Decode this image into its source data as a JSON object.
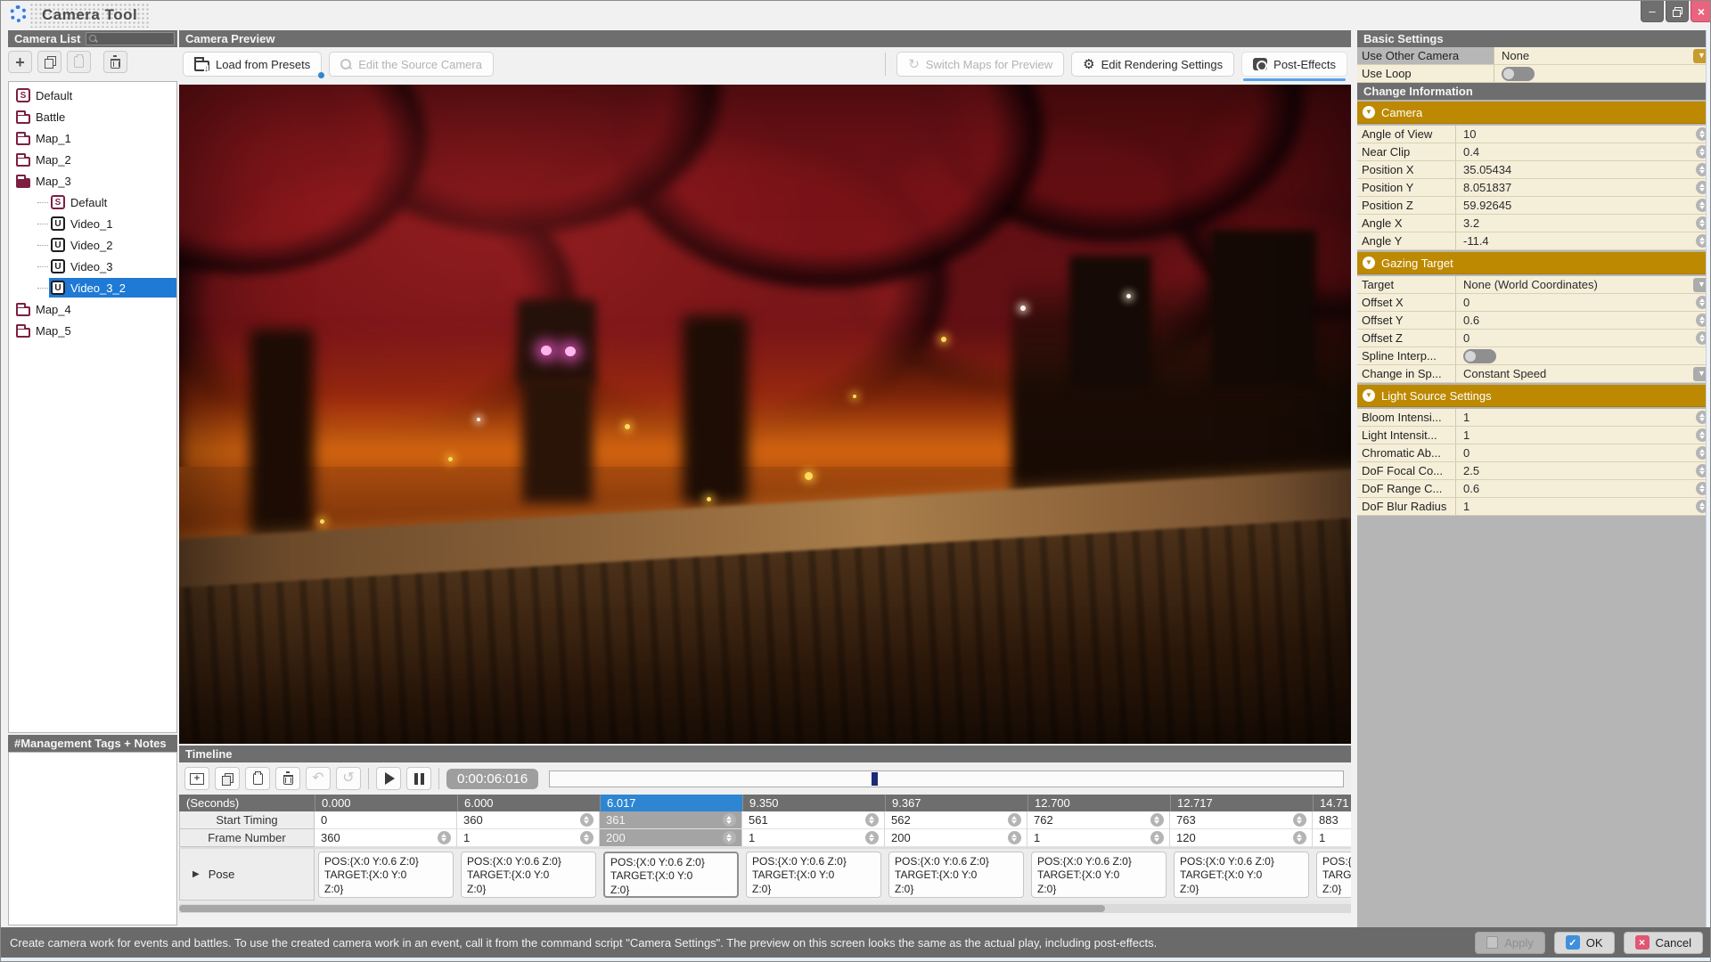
{
  "window": {
    "title": "Camera Tool"
  },
  "icons": {
    "chevron_down": "▼",
    "minimize": "–",
    "close": "×",
    "undo": "↶",
    "redo": "↺",
    "gear": "⚙",
    "refresh": "↻",
    "triangle_right": "▶"
  },
  "camera_list": {
    "title": "Camera List",
    "search_placeholder": "",
    "tree": [
      {
        "label": "Default",
        "icon": "script",
        "depth": 0,
        "selected": false
      },
      {
        "label": "Battle",
        "icon": "folder",
        "depth": 0,
        "selected": false
      },
      {
        "label": "Map_1",
        "icon": "folder",
        "depth": 0,
        "selected": false
      },
      {
        "label": "Map_2",
        "icon": "folder",
        "depth": 0,
        "selected": false
      },
      {
        "label": "Map_3",
        "icon": "folder-open",
        "depth": 0,
        "selected": false
      },
      {
        "label": "Default",
        "icon": "script",
        "depth": 1,
        "selected": false
      },
      {
        "label": "Video_1",
        "icon": "video",
        "depth": 1,
        "selected": false
      },
      {
        "label": "Video_2",
        "icon": "video",
        "depth": 1,
        "selected": false
      },
      {
        "label": "Video_3",
        "icon": "video",
        "depth": 1,
        "selected": false
      },
      {
        "label": "Video_3_2",
        "icon": "video",
        "depth": 1,
        "selected": true
      },
      {
        "label": "Map_4",
        "icon": "folder",
        "depth": 0,
        "selected": false
      },
      {
        "label": "Map_5",
        "icon": "folder",
        "depth": 0,
        "selected": false
      }
    ]
  },
  "management_tags": {
    "title": "#Management Tags + Notes"
  },
  "preview": {
    "title": "Camera Preview",
    "toolbar_left": [
      {
        "label": "Load from Presets",
        "enabled": true
      },
      {
        "label": "Edit the Source Camera",
        "enabled": false
      }
    ],
    "toolbar_right": [
      {
        "label": "Switch Maps for Preview",
        "enabled": false,
        "active": false
      },
      {
        "label": "Edit Rendering Settings",
        "enabled": true,
        "active": false
      },
      {
        "label": "Post-Effects",
        "enabled": true,
        "active": true
      }
    ]
  },
  "settings": {
    "basic_title": "Basic Settings",
    "rows_basic": [
      {
        "label": "Use Other Camera",
        "value": "None",
        "control": "dropdown-gold",
        "label_highlight": true
      },
      {
        "label": "Use Loop",
        "value": "",
        "control": "toggle-off",
        "label_highlight": false
      }
    ],
    "change_title": "Change Information",
    "sections": [
      {
        "title": "Camera",
        "rows": [
          {
            "label": "Angle of View",
            "value": "10",
            "control": "spinner"
          },
          {
            "label": "Near Clip",
            "value": "0.4",
            "control": "spinner"
          },
          {
            "label": "Position X",
            "value": "35.05434",
            "control": "spinner"
          },
          {
            "label": "Position Y",
            "value": "8.051837",
            "control": "spinner"
          },
          {
            "label": "Position Z",
            "value": "59.92645",
            "control": "spinner"
          },
          {
            "label": "Angle X",
            "value": "3.2",
            "control": "spinner"
          },
          {
            "label": "Angle Y",
            "value": "-11.4",
            "control": "spinner"
          }
        ]
      },
      {
        "title": "Gazing Target",
        "rows": [
          {
            "label": "Target",
            "value": "None (World Coordinates)",
            "control": "dropdown"
          },
          {
            "label": "Offset X",
            "value": "0",
            "control": "spinner"
          },
          {
            "label": "Offset Y",
            "value": "0.6",
            "control": "spinner"
          },
          {
            "label": "Offset Z",
            "value": "0",
            "control": "spinner"
          },
          {
            "label": "Spline Interp...",
            "value": "",
            "control": "toggle-off"
          },
          {
            "label": "Change in Sp...",
            "value": "Constant Speed",
            "control": "dropdown"
          }
        ]
      },
      {
        "title": "Light Source Settings",
        "rows": [
          {
            "label": "Bloom Intensi...",
            "value": "1",
            "control": "spinner"
          },
          {
            "label": "Light Intensit...",
            "value": "1",
            "control": "spinner"
          },
          {
            "label": "Chromatic Ab...",
            "value": "0",
            "control": "spinner"
          },
          {
            "label": "DoF Focal Co...",
            "value": "2.5",
            "control": "spinner"
          },
          {
            "label": "DoF Range C...",
            "value": "0.6",
            "control": "spinner"
          },
          {
            "label": "DoF Blur Radius",
            "value": "1",
            "control": "spinner"
          }
        ]
      }
    ]
  },
  "timeline": {
    "title": "Timeline",
    "time_display": "0:00:06:016",
    "playhead_fraction": 0.406,
    "header_label": "(Seconds)",
    "row_labels": {
      "start_timing": "Start Timing",
      "frame_number": "Frame Number",
      "pose": "Pose"
    },
    "columns": [
      {
        "seconds": "0.000",
        "start_timing": "0",
        "frame_number": "360",
        "selected": false,
        "st_spinner": false
      },
      {
        "seconds": "6.000",
        "start_timing": "360",
        "frame_number": "1",
        "selected": false
      },
      {
        "seconds": "6.017",
        "start_timing": "361",
        "frame_number": "200",
        "selected": true
      },
      {
        "seconds": "9.350",
        "start_timing": "561",
        "frame_number": "1",
        "selected": false
      },
      {
        "seconds": "9.367",
        "start_timing": "562",
        "frame_number": "200",
        "selected": false
      },
      {
        "seconds": "12.700",
        "start_timing": "762",
        "frame_number": "1",
        "selected": false
      },
      {
        "seconds": "12.717",
        "start_timing": "763",
        "frame_number": "120",
        "selected": false
      },
      {
        "seconds": "14.71",
        "start_timing": "883",
        "frame_number": "1",
        "selected": false
      }
    ],
    "pose_lines": [
      "POS:{X:0 Y:0.6 Z:0}",
      "TARGET:{X:0 Y:0",
      "Z:0}"
    ]
  },
  "status_bar": {
    "message": "Create camera work for events and battles. To use the created camera work in an event, call it from the command script \"Camera Settings\". The preview on this screen looks the same as the actual play, including post-effects.",
    "apply_label": "Apply",
    "ok_label": "OK",
    "cancel_label": "Cancel"
  },
  "colors": {
    "selection_blue": "#1e7ad4",
    "column_selected_blue": "#2e86d3",
    "gold_header": "#bd8900",
    "cream_row": "#f5efda",
    "ok_blue": "#3f8fdc",
    "cancel_pink": "#e05673"
  }
}
